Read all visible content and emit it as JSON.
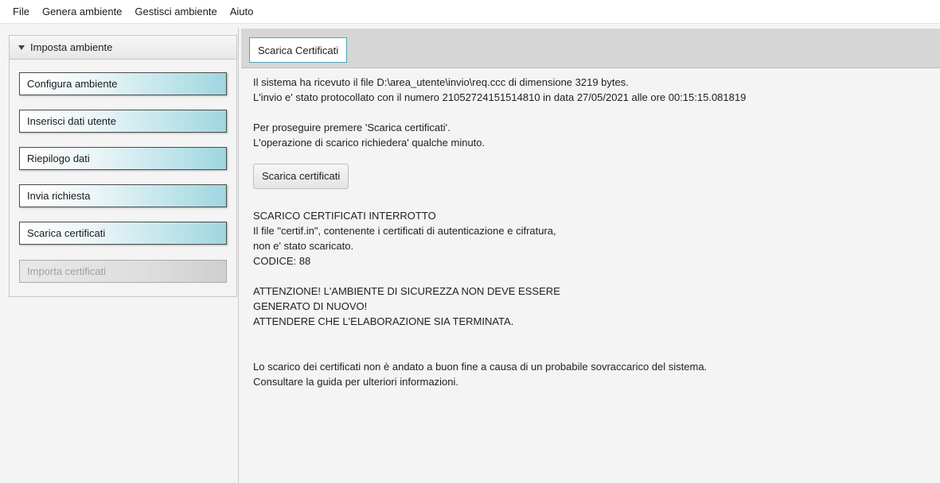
{
  "menubar": {
    "items": [
      "File",
      "Genera ambiente",
      "Gestisci ambiente",
      "Aiuto"
    ]
  },
  "sidebar": {
    "section_title": "Imposta ambiente",
    "items": [
      {
        "label": "Configura ambiente",
        "enabled": true
      },
      {
        "label": "Inserisci dati utente",
        "enabled": true
      },
      {
        "label": "Riepilogo dati",
        "enabled": true
      },
      {
        "label": "Invia richiesta",
        "enabled": true
      },
      {
        "label": "Scarica certificati",
        "enabled": true
      },
      {
        "label": "Importa certificati",
        "enabled": false
      }
    ]
  },
  "main": {
    "tab_label": "Scarica Certificati",
    "para1": [
      "Il sistema ha ricevuto il file D:\\area_utente\\invio\\req.ccc di dimensione 3219 bytes.",
      "L'invio e' stato protocollato con il numero 21052724151514810 in data 27/05/2021 alle ore 00:15:15.081819"
    ],
    "para2": [
      "Per proseguire premere 'Scarica certificati'.",
      "L'operazione di scarico richiedera' qualche minuto."
    ],
    "download_button_label": "Scarica certificati",
    "para3": [
      "SCARICO CERTIFICATI INTERROTTO",
      "Il file \"certif.in\", contenente i certificati di autenticazione e cifratura,",
      "non e' stato scaricato.",
      "CODICE: 88"
    ],
    "para4": [
      "ATTENZIONE! L'AMBIENTE DI SICUREZZA NON DEVE ESSERE",
      "GENERATO DI NUOVO!",
      "ATTENDERE CHE L'ELABORAZIONE SIA TERMINATA."
    ],
    "para5": [
      "Lo scarico dei certificati non è andato a buon fine a causa di un probabile sovraccarico del sistema.",
      "Consultare la guida per ulteriori informazioni."
    ]
  },
  "colors": {
    "button_gradient_end": "#9fd6df",
    "tab_border": "#4aa8b8"
  }
}
